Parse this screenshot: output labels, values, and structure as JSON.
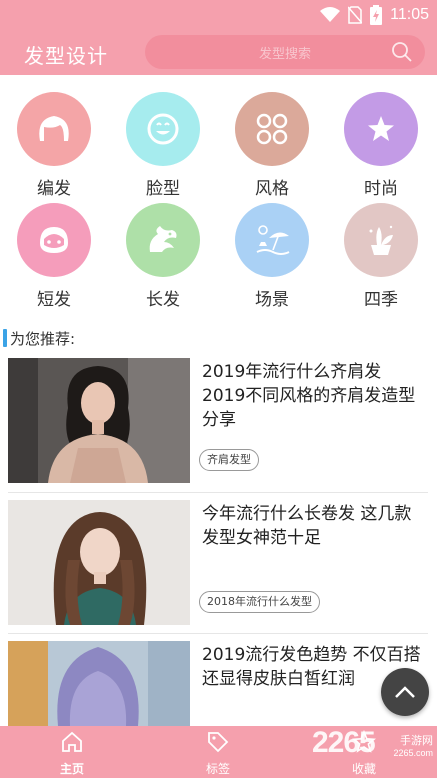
{
  "status": {
    "time": "11:05"
  },
  "header": {
    "title": "发型设计",
    "search_placeholder": "发型搜索"
  },
  "categories": [
    {
      "label": "编发",
      "color": "#f4a5a7",
      "icon": "hair-icon"
    },
    {
      "label": "脸型",
      "color": "#a6ecee",
      "icon": "smiley-icon"
    },
    {
      "label": "风格",
      "color": "#dba99a",
      "icon": "clover-icon"
    },
    {
      "label": "时尚",
      "color": "#c39be6",
      "icon": "star-icon"
    },
    {
      "label": "短发",
      "color": "#f59dbb",
      "icon": "face-icon"
    },
    {
      "label": "长发",
      "color": "#aee0a8",
      "icon": "dragon-icon"
    },
    {
      "label": "场景",
      "color": "#aad1f5",
      "icon": "beach-icon"
    },
    {
      "label": "四季",
      "color": "#e2c7c5",
      "icon": "plant-icon"
    }
  ],
  "recommend": {
    "title": "为您推荐:"
  },
  "articles": [
    {
      "title": "2019年流行什么齐肩发 2019不同风格的齐肩发造型分享",
      "tag": "齐肩发型"
    },
    {
      "title": "今年流行什么长卷发 这几款发型女神范十足",
      "tag": "2018年流行什么发型"
    },
    {
      "title": "2019流行发色趋势 不仅百搭还显得皮肤白皙红润",
      "tag": ""
    }
  ],
  "tabs": [
    {
      "label": "主页",
      "icon": "home-icon"
    },
    {
      "label": "标签",
      "icon": "tag-icon"
    },
    {
      "label": "收藏",
      "icon": "star-icon"
    }
  ],
  "watermark": {
    "brand": "2265",
    "cn": "手游网",
    "url": "2265.com"
  },
  "colors": {
    "brand_pink": "#f5a0ad",
    "accent_blue": "#3ba3e6"
  }
}
